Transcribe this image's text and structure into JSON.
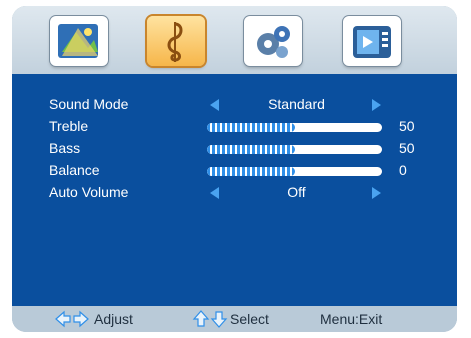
{
  "tabs": [
    {
      "icon": "picture-icon",
      "active": false
    },
    {
      "icon": "music-note-icon",
      "active": true
    },
    {
      "icon": "gear-icon",
      "active": false
    },
    {
      "icon": "tv-setup-icon",
      "active": false
    }
  ],
  "menu": {
    "sound_mode": {
      "label": "Sound Mode",
      "value": "Standard"
    },
    "treble": {
      "label": "Treble",
      "value": "50",
      "level": 50
    },
    "bass": {
      "label": "Bass",
      "value": "50",
      "level": 50
    },
    "balance": {
      "label": "Balance",
      "value": "0",
      "level": 50
    },
    "auto_volume": {
      "label": "Auto Volume",
      "value": "Off"
    }
  },
  "footer": {
    "adjust": "Adjust",
    "select": "Select",
    "menu_exit": "Menu:Exit"
  },
  "colors": {
    "panel": "#0a4f9e",
    "active_tab": "#f6b64a",
    "arrow": "#4aa3f0"
  }
}
